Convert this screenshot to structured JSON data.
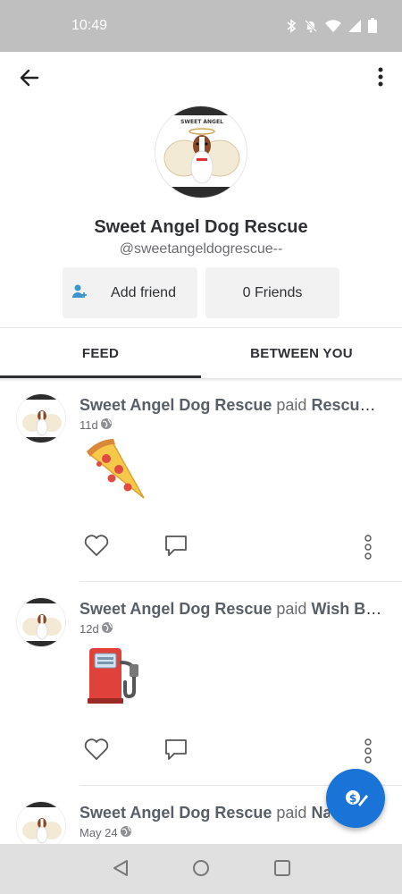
{
  "status_bar": {
    "time": "10:49",
    "icons": [
      "bluetooth-icon",
      "bell-off-icon",
      "wifi-icon",
      "signal-icon",
      "battery-icon"
    ]
  },
  "app_bar": {
    "back_icon": "arrow-left-icon",
    "menu_icon": "more-vertical-icon"
  },
  "profile": {
    "name": "Sweet Angel Dog Rescue",
    "handle": "@sweetangeldogrescue--",
    "avatar_text": "SWEET ANGEL",
    "add_friend_label": "Add friend",
    "friends_label": "0 Friends"
  },
  "tabs": [
    {
      "label": "FEED",
      "active": true
    },
    {
      "label": "BETWEEN YOU",
      "active": false
    }
  ],
  "feed": [
    {
      "actor": "Sweet Angel Dog Rescue",
      "verb": "paid",
      "target": "Rescue Kitchen",
      "time": "11d",
      "emoji": "pizza"
    },
    {
      "actor": "Sweet Angel Dog Rescue",
      "verb": "paid",
      "target": "Wish Bone",
      "time": "12d",
      "emoji": "fuel-pump"
    },
    {
      "actor": "Sweet Angel Dog Rescue",
      "verb": "paid",
      "target": "Nad",
      "time": "May 24",
      "emoji": ""
    }
  ],
  "colors": {
    "accent": "#1a74d8",
    "status_bar": "#bfbfbf",
    "nav_bar": "#e0e0e0",
    "text_primary": "#2f3033"
  }
}
